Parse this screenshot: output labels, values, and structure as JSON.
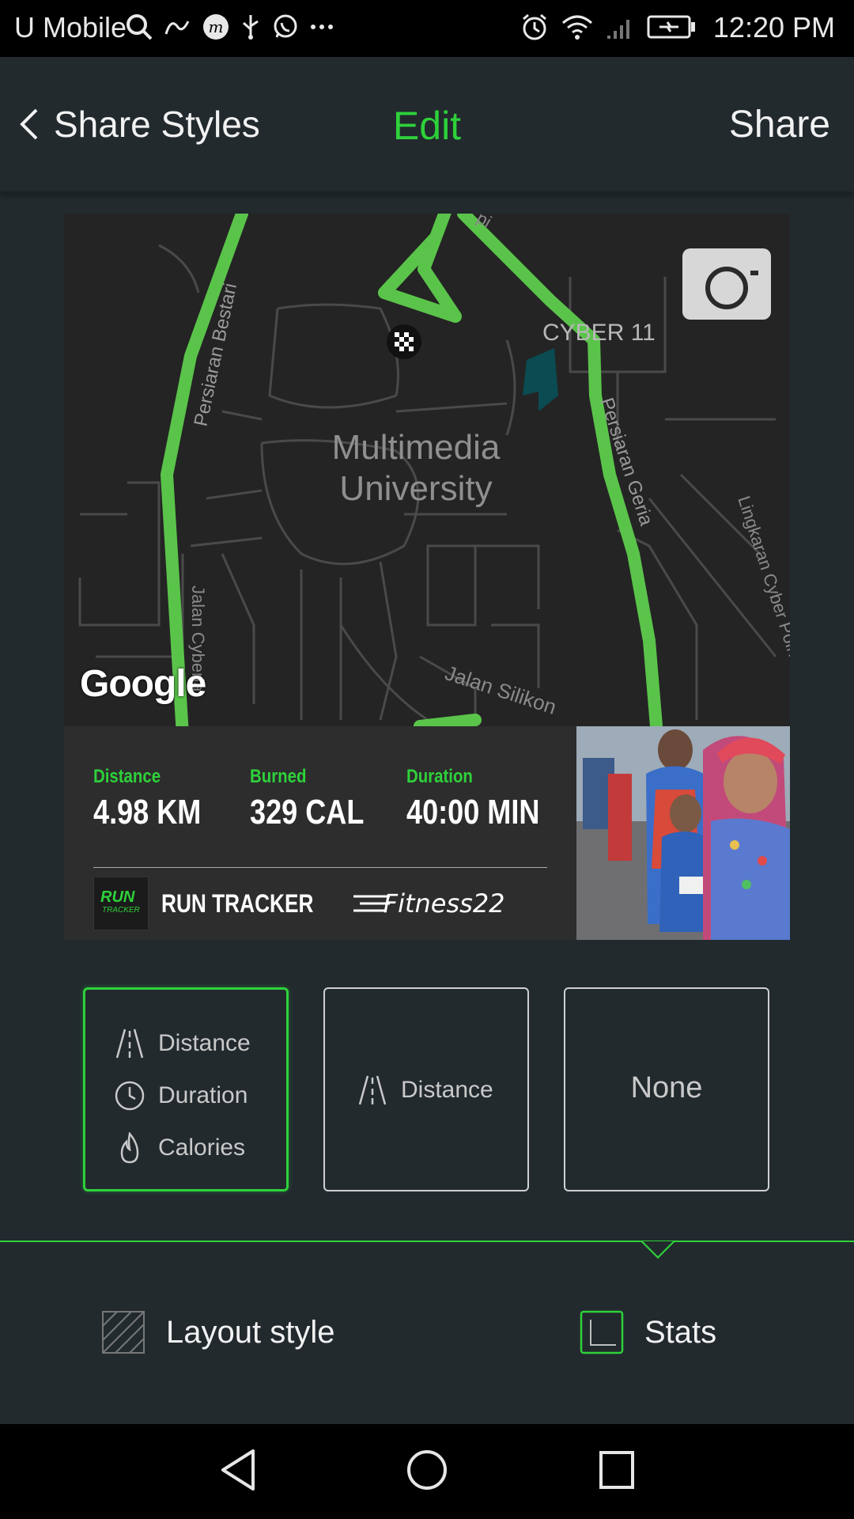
{
  "status_bar": {
    "carrier": "U Mobile",
    "time": "12:20 PM",
    "left_icons": [
      "search-icon",
      "swirl-icon",
      "m-app-icon",
      "usb-icon",
      "whatsapp-icon",
      "more-icon"
    ],
    "right_icons": [
      "alarm-icon",
      "wifi-icon",
      "signal-icon",
      "battery-charging-icon"
    ]
  },
  "toolbar": {
    "back_label": "Share Styles",
    "title": "Edit",
    "share_label": "Share"
  },
  "map": {
    "labels": {
      "university": "Multimedia University",
      "cyber": "CYBER 11",
      "road_bestari": "Persiaran Bestari",
      "road_geria": "Persiaran Geria",
      "road_lingkaran": "Lingkaran Cyber Point B",
      "road_silikon": "Jalan Silikon",
      "road_cyberia": "Jalan Cyberia",
      "top_road": "pi"
    },
    "google_logo": "Google",
    "camera_icon": "camera-icon",
    "route_color": "#5ac44a"
  },
  "stats": {
    "distance_label": "Distance",
    "distance_value": "4.98 KM",
    "burned_label": "Burned",
    "burned_value": "329 CAL",
    "duration_label": "Duration",
    "duration_value": "40:00 MIN",
    "accent": "#2ed13a"
  },
  "brand": {
    "logo_top": "RUN",
    "logo_bottom": "TRACKER",
    "name": "RUN TRACKER",
    "sub": "Fitness22"
  },
  "options": [
    {
      "rows": [
        "Distance",
        "Duration",
        "Calories"
      ],
      "selected": true
    },
    {
      "rows": [
        "Distance"
      ],
      "selected": false
    },
    {
      "label": "None",
      "selected": false
    }
  ],
  "bottom_tabs": {
    "layout_label": "Layout style",
    "stats_label": "Stats"
  }
}
